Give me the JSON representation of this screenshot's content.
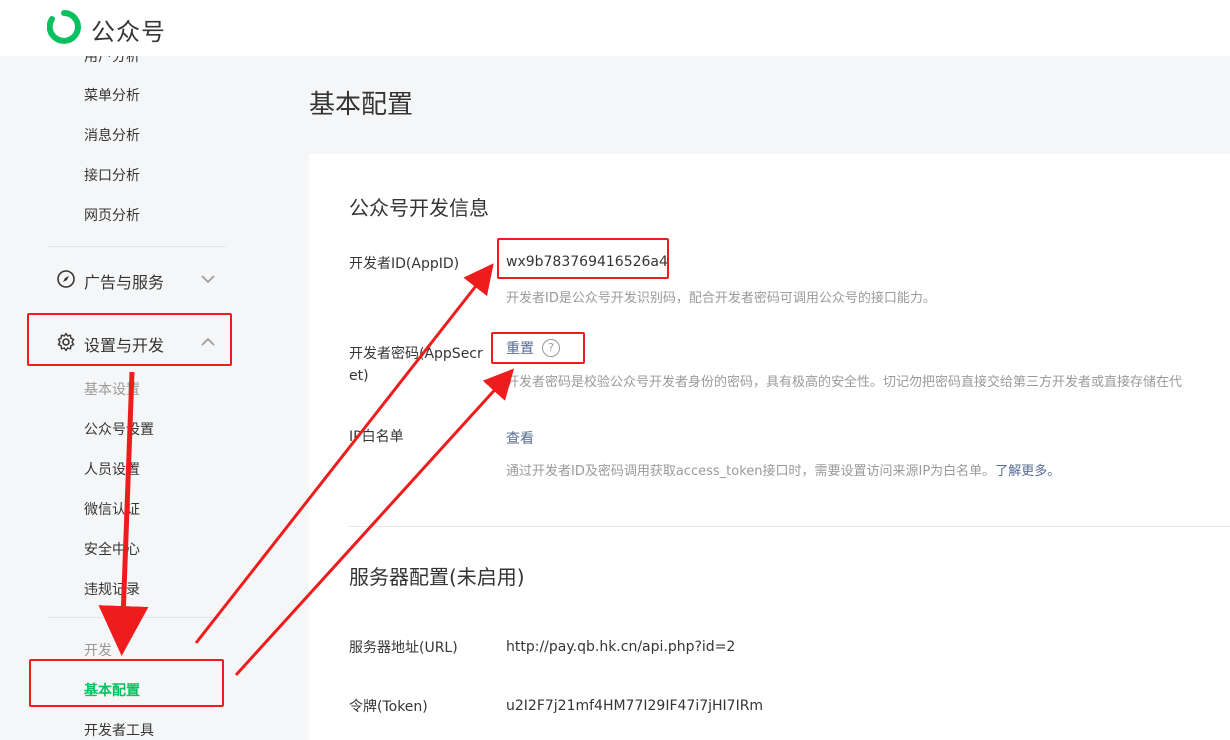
{
  "brand": {
    "name": "公众号",
    "color": "#07c160"
  },
  "sidebar": {
    "top_items": [
      {
        "label": "用户分析"
      },
      {
        "label": "菜单分析"
      },
      {
        "label": "消息分析"
      },
      {
        "label": "接口分析"
      },
      {
        "label": "网页分析"
      }
    ],
    "groups": [
      {
        "label": "广告与服务",
        "icon": "compass-icon",
        "expanded": false
      },
      {
        "label": "设置与开发",
        "icon": "gear-icon",
        "expanded": true
      }
    ],
    "settings_section_label": "基本设置",
    "settings_items": [
      {
        "label": "公众号设置"
      },
      {
        "label": "人员设置"
      },
      {
        "label": "微信认证"
      },
      {
        "label": "安全中心"
      },
      {
        "label": "违规记录"
      }
    ],
    "dev_section_label": "开发",
    "dev_items": [
      {
        "label": "基本配置",
        "active": true
      },
      {
        "label": "开发者工具"
      }
    ]
  },
  "main": {
    "page_title": "基本配置",
    "dev_info": {
      "title": "公众号开发信息",
      "appid_label": "开发者ID(AppID)",
      "appid_value": "wx9b783769416526a4",
      "appid_hint": "开发者ID是公众号开发识别码，配合开发者密码可调用公众号的接口能力。",
      "secret_label": "开发者密码(AppSecret)",
      "secret_action": "重置",
      "secret_hint": "开发者密码是校验公众号开发者身份的密码，具有极高的安全性。切记勿把密码直接交给第三方开发者或直接存储在代",
      "ip_label": "IP白名单",
      "ip_action": "查看",
      "ip_hint_text": "通过开发者ID及密码调用获取access_token接口时，需要设置访问来源IP为白名单。",
      "ip_hint_link": "了解更多。"
    },
    "server_config": {
      "title": "服务器配置(未启用)",
      "url_label": "服务器地址(URL)",
      "url_value": "http://pay.qb.hk.cn/api.php?id=2",
      "token_label": "令牌(Token)",
      "token_value": "u2I2F7j21mf4HM77I29IF47i7jHI7IRm"
    }
  },
  "annotation_color": "#ee1c1c"
}
